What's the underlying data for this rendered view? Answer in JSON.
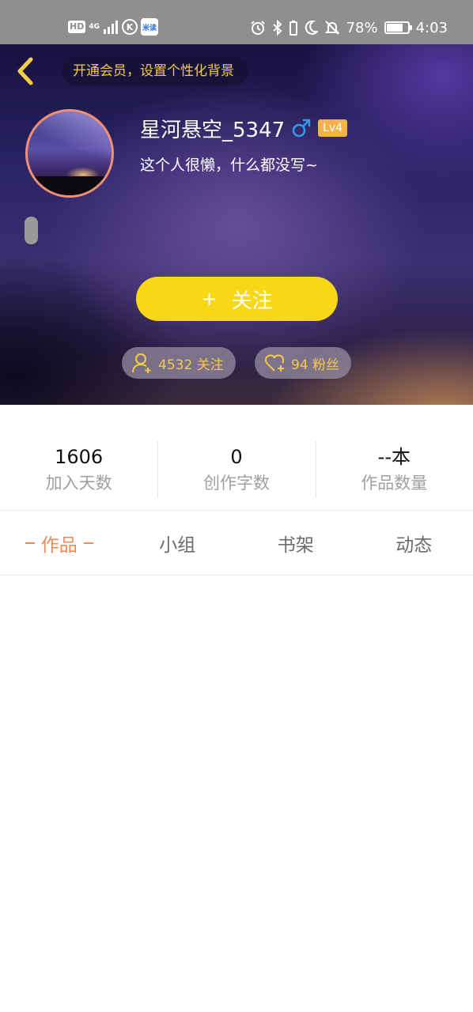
{
  "status_bar": {
    "hd": "HD",
    "network": "4G",
    "k_icon": "K",
    "app_icon_text": "米读",
    "battery_percent": "78%",
    "battery_level": 0.78,
    "time": "4:03",
    "icons": [
      "hd-icon",
      "signal-icon",
      "k-app-icon",
      "app-icon",
      "alarm-icon",
      "bluetooth-icon",
      "battery-saver-icon",
      "moon-icon",
      "mute-bell-icon",
      "battery-icon"
    ]
  },
  "header": {
    "back_icon": "chevron-left-icon",
    "vip_banner": "开通会员，设置个性化背景",
    "username": "星河悬空_5347",
    "gender_icon": "male-icon",
    "level": "Lv4",
    "bio": "这个人很懒，什么都没写~",
    "follow_button": {
      "plus": "+",
      "label": "关注"
    },
    "following_pill": {
      "icon": "user-add-icon",
      "text": "4532 关注"
    },
    "fans_pill": {
      "icon": "heart-icon",
      "text": "94 粉丝"
    }
  },
  "stats": [
    {
      "value": "1606",
      "label": "加入天数"
    },
    {
      "value": "0",
      "label": "创作字数"
    },
    {
      "value": "--本",
      "label": "作品数量"
    }
  ],
  "tabs": [
    {
      "label": "作品",
      "active": true
    },
    {
      "label": "小组",
      "active": false
    },
    {
      "label": "书架",
      "active": false
    },
    {
      "label": "动态",
      "active": false
    }
  ],
  "colors": {
    "accent_yellow": "#f8d714",
    "banner_text": "#f6c944",
    "active_tab": "#f08a55",
    "level_badge": "#f2b24a",
    "avatar_ring": "#f08f74"
  }
}
